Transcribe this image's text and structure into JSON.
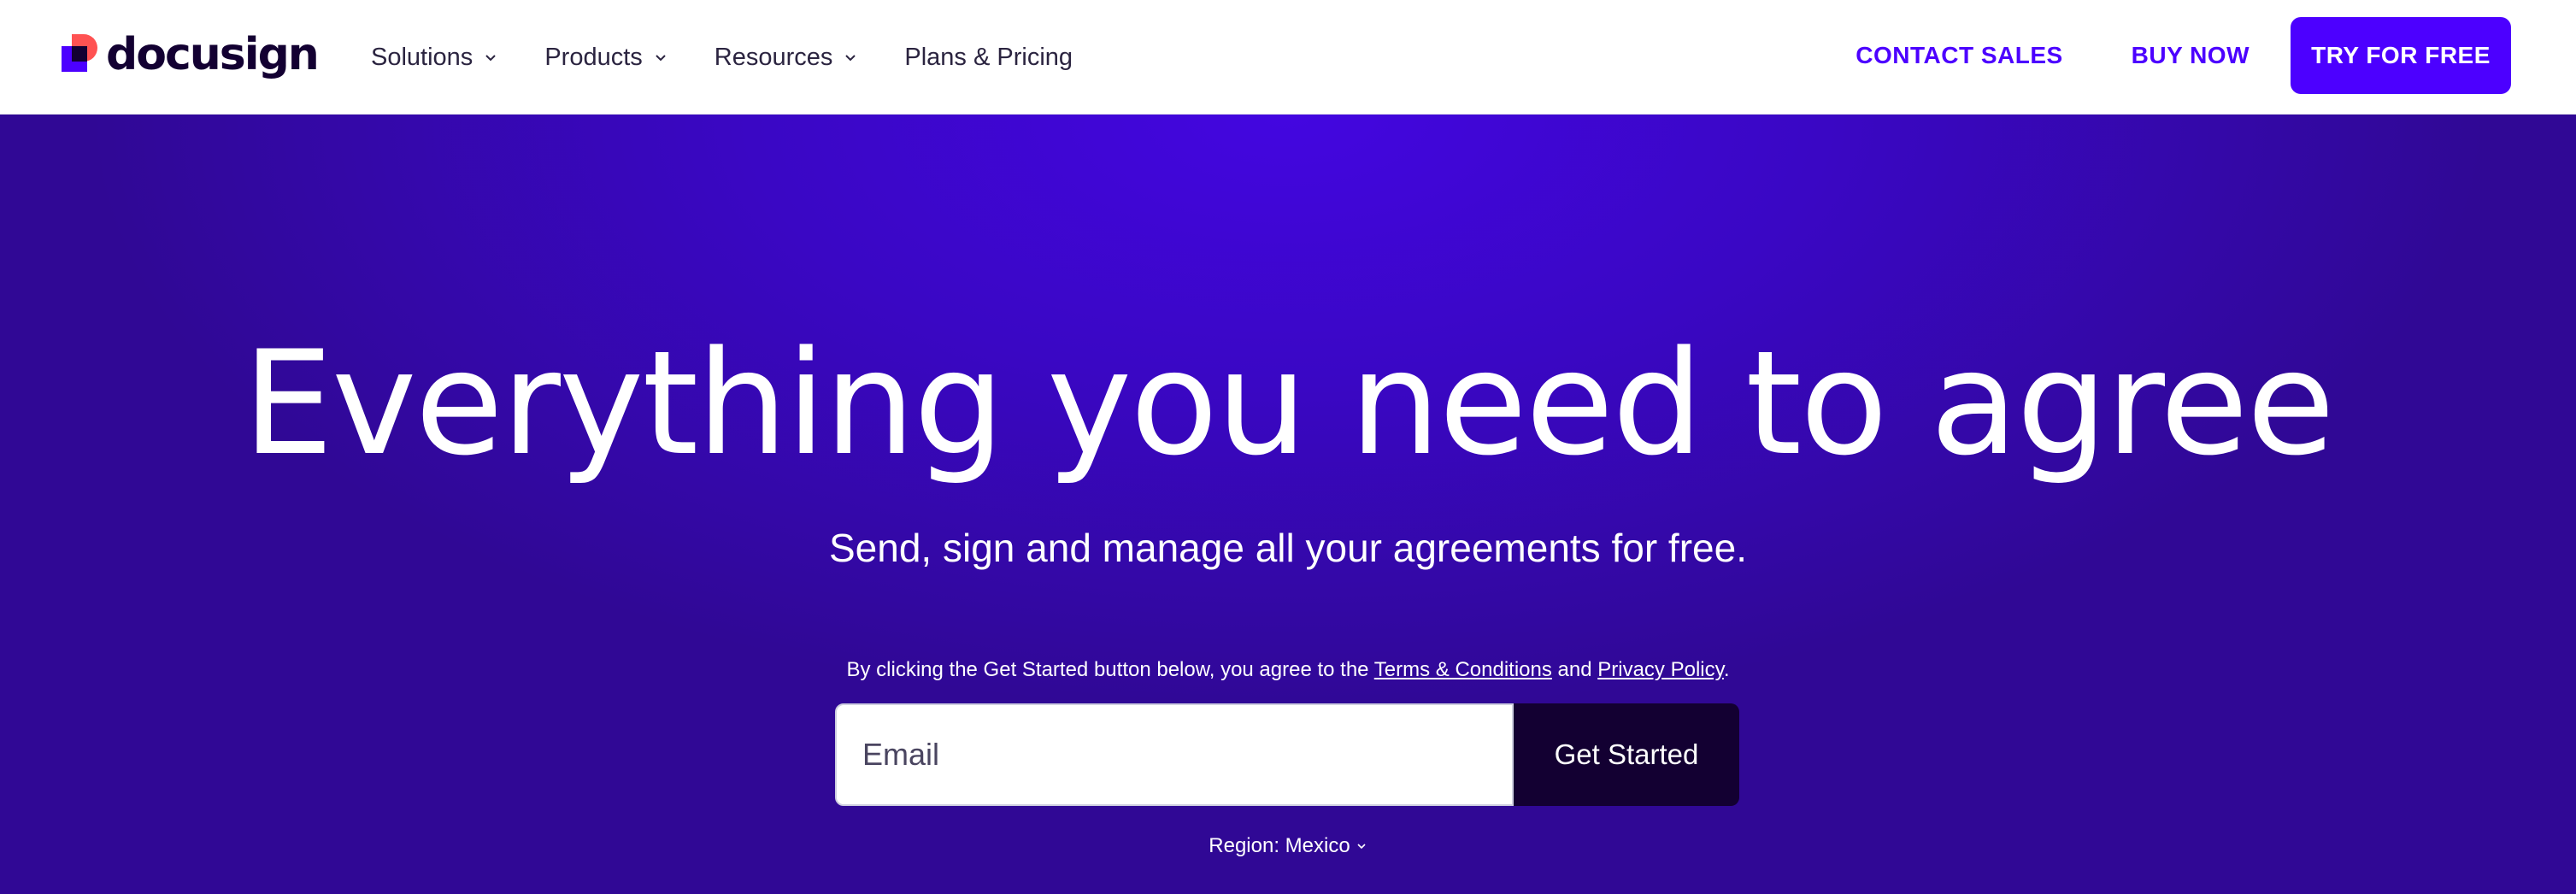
{
  "brand": {
    "name": "docusign",
    "colors": {
      "primary": "#4c00ff",
      "accent_red": "#ff5252",
      "ink": "#130032",
      "hero_bg": "#3a07c4"
    }
  },
  "nav": {
    "items": [
      {
        "label": "Solutions",
        "has_dropdown": true
      },
      {
        "label": "Products",
        "has_dropdown": true
      },
      {
        "label": "Resources",
        "has_dropdown": true
      },
      {
        "label": "Plans & Pricing",
        "has_dropdown": false
      }
    ]
  },
  "header_actions": {
    "contact_sales": "CONTACT SALES",
    "buy_now": "BUY NOW",
    "try_free": "TRY FOR FREE"
  },
  "hero": {
    "title": "Everything you need to agree",
    "subtitle": "Send, sign and manage all your agreements for free.",
    "consent": {
      "prefix": "By clicking the Get Started button below, you agree to the ",
      "terms_label": "Terms & Conditions",
      "middle": " and ",
      "privacy_label": "Privacy Policy",
      "suffix": "."
    },
    "email_placeholder": "Email",
    "cta_label": "Get Started",
    "region": {
      "label": "Region: Mexico"
    }
  },
  "icons": {
    "chevron": "chevron-down-icon",
    "logo": "docusign-logo-icon"
  }
}
